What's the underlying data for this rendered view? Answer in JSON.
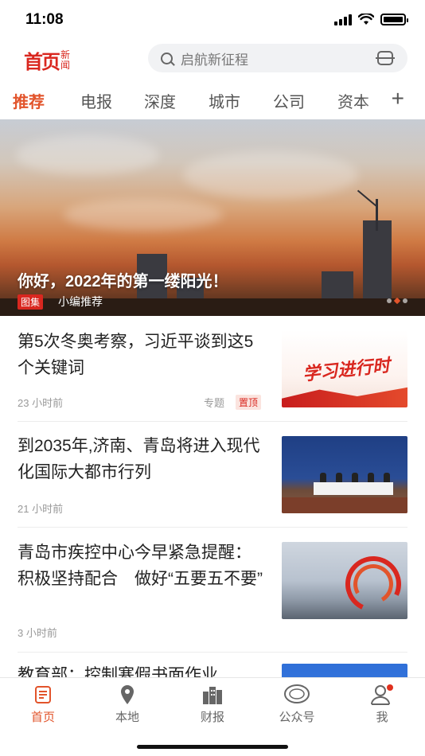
{
  "status_bar": {
    "time": "11:08"
  },
  "header": {
    "logo_main": "首页",
    "logo_sub_1": "新",
    "logo_sub_2": "闻",
    "search_placeholder": "启航新征程"
  },
  "tabs": [
    "推荐",
    "电报",
    "深度",
    "城市",
    "公司",
    "资本"
  ],
  "banner": {
    "title": "你好，2022年的第一缕阳光！",
    "tag": "图集",
    "subtitle": "小编推荐"
  },
  "news": [
    {
      "title": "第5次冬奥考察，习近平谈到这5个关键词",
      "time": "23 小时前",
      "label": "专题",
      "badge": "置顶",
      "thumb_text": "学习进行时"
    },
    {
      "title": "到2035年,济南、青岛将进入现代化国际大都市行列",
      "time": "21 小时前"
    },
    {
      "title": "青岛市疾控中心今早紧急提醒：积极坚持配合　做好“五要五不要”",
      "time": "3 小时前"
    },
    {
      "title": "教育部：控制寒假书面作业"
    }
  ],
  "bottom_nav": [
    {
      "label": "首页",
      "icon": "news-icon",
      "active": true
    },
    {
      "label": "本地",
      "icon": "location-pin-icon"
    },
    {
      "label": "财报",
      "icon": "buildings-icon"
    },
    {
      "label": "公众号",
      "icon": "chat-bubble-icon"
    },
    {
      "label": "我",
      "icon": "user-icon"
    }
  ],
  "colors": {
    "accent": "#e2542b",
    "brand_red": "#d9271f"
  }
}
